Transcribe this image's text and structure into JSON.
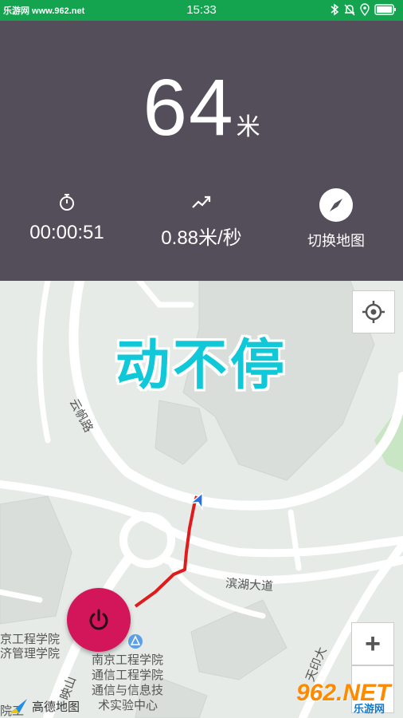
{
  "status_bar": {
    "site_text": "乐游网 www.962.net",
    "time": "15:33",
    "icons": [
      "bluetooth-icon",
      "bell-muted-icon",
      "location-icon",
      "battery-icon"
    ]
  },
  "tracker": {
    "distance_value": "64",
    "distance_unit": "米",
    "elapsed_time": "00:00:51",
    "speed": "0.88米/秒",
    "switch_map_label": "切换地图"
  },
  "map": {
    "watermark": "动不停",
    "roads": {
      "yunfan": "云帆路",
      "binhu": "滨湖大道",
      "tianyin": "天印大",
      "yingshan": "映山"
    },
    "pois": {
      "left_top": "京工程学院",
      "left_bottom": "济管理学院",
      "center_line1": "南京工程学院",
      "center_line2": "通信工程学院",
      "center_line3": "通信与信息技",
      "center_line4": "术实验中心",
      "bottom_left": "院工"
    },
    "attribution": "高德地图",
    "zoom_in_label": "+",
    "site_logo_text": "962.NET",
    "site_logo_sub": "乐游网"
  },
  "colors": {
    "status_bar": "#14a44f",
    "header_bg": "#544e5a",
    "track_line": "#e01b1b",
    "power_button": "#d3155a",
    "watermark": "#10c8d8"
  }
}
